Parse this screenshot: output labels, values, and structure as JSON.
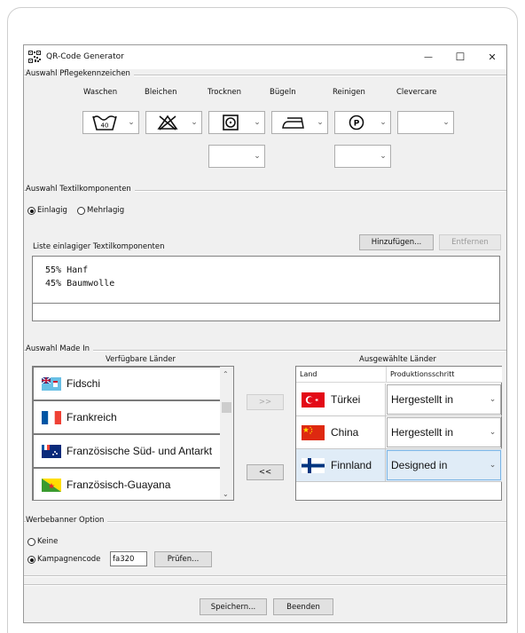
{
  "window": {
    "title": "QR-Code Generator",
    "controls": {
      "minimize": "—",
      "maximize": "☐",
      "close": "✕"
    }
  },
  "care": {
    "group_title": "Auswahl Pflegekennzeichen",
    "columns": [
      {
        "label": "Waschen",
        "icon": "wash-40-icon",
        "value_text": "40"
      },
      {
        "label": "Bleichen",
        "icon": "no-bleach-icon"
      },
      {
        "label": "Trocknen",
        "icon": "tumble-dry-icon"
      },
      {
        "label": "Bügeln",
        "icon": "iron-icon"
      },
      {
        "label": "Reinigen",
        "icon": "dry-clean-p-icon",
        "value_text": "P"
      },
      {
        "label": "Clevercare",
        "icon": ""
      }
    ]
  },
  "textile": {
    "group_title": "Auswahl Textilkomponenten",
    "radio_single": "Einlagig",
    "radio_multi": "Mehrlagig",
    "selected": "Einlagig",
    "list_label": "Liste einlagiger Textilkomponenten",
    "add_button": "Hinzufügen...",
    "remove_button": "Entfernen",
    "lines": [
      "55% Hanf",
      "45% Baumwolle"
    ]
  },
  "made_in": {
    "group_title": "Auswahl Made In",
    "available_label": "Verfügbare Länder",
    "selected_label": "Ausgewählte Länder",
    "available": [
      {
        "name": "Fidschi",
        "flag": "fiji-flag-icon"
      },
      {
        "name": "Frankreich",
        "flag": "france-flag-icon"
      },
      {
        "name": "Französische Süd- und Antarkt",
        "flag": "french-southern-flag-icon"
      },
      {
        "name": "Französisch-Guayana",
        "flag": "french-guiana-flag-icon"
      }
    ],
    "add_button": ">>",
    "remove_button": "<<",
    "table_headers": {
      "land": "Land",
      "step": "Produktionsschritt"
    },
    "selected": [
      {
        "land": "Türkei",
        "flag": "turkey-flag-icon",
        "step": "Hergestellt in"
      },
      {
        "land": "China",
        "flag": "china-flag-icon",
        "step": "Hergestellt in"
      },
      {
        "land": "Finnland",
        "flag": "finland-flag-icon",
        "step": "Designed in"
      }
    ]
  },
  "banner": {
    "group_title": "Werbebanner Option",
    "radio_none": "Keine",
    "radio_campaign": "Kampagnencode",
    "selected": "Kampagnencode",
    "code_value": "fa320",
    "check_button": "Prüfen..."
  },
  "footer": {
    "save_button": "Speichern...",
    "exit_button": "Beenden"
  }
}
